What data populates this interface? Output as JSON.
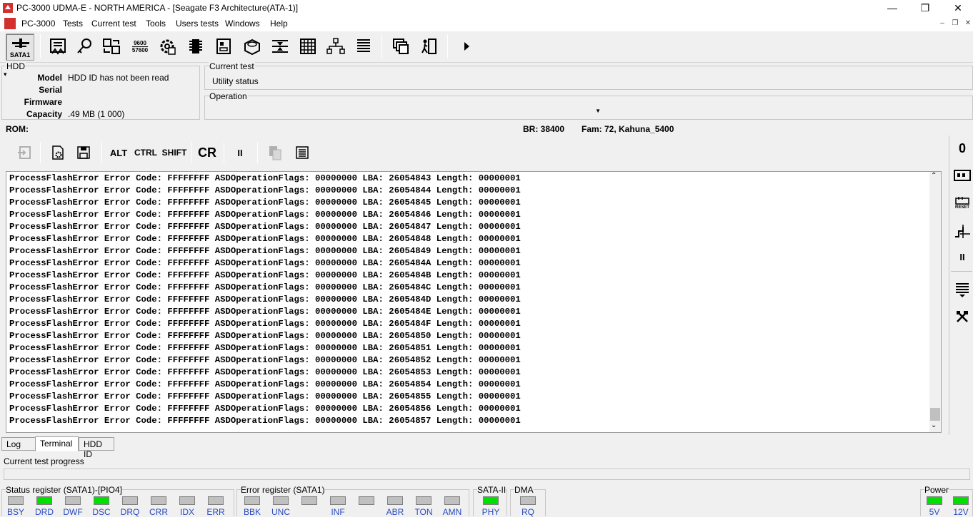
{
  "window": {
    "title": "PC-3000 UDMA-E - NORTH AMERICA - [Seagate F3 Architecture(ATA-1)]",
    "minimize": "—",
    "restore": "❐",
    "close": "✕"
  },
  "menu": {
    "items": [
      "PC-3000",
      "Tests",
      "Current test",
      "Tools",
      "Users tests",
      "Windows",
      "Help"
    ],
    "mdi_min": "–",
    "mdi_restore": "❐",
    "mdi_close": "✕"
  },
  "toolbar": {
    "sata_label": "SATA1",
    "baud_top": "9600",
    "baud_bottom": "57600"
  },
  "hdd": {
    "title": "HDD",
    "model_label": "Model",
    "model_value": "HDD ID has not been read",
    "serial_label": "Serial",
    "serial_value": "",
    "firmware_label": "Firmware",
    "firmware_value": "",
    "capacity_label": "Capacity",
    "capacity_value": ".49 MB (1 000)"
  },
  "current_test": {
    "title": "Current test",
    "value": "Utility status"
  },
  "operation": {
    "title": "Operation",
    "value": ""
  },
  "status_bar": {
    "rom": "ROM:",
    "br": "BR: 38400",
    "fam": "Fam: 72, Kahuna_5400"
  },
  "term_toolbar": {
    "alt": "ALT",
    "ctrl": "CTRL",
    "shift": "SHIFT",
    "cr": "CR",
    "pause": "II"
  },
  "terminal": {
    "lines": [
      "ProcessFlashError Error Code: FFFFFFFF ASDOperationFlags: 00000000 LBA: 26054843 Length: 00000001",
      "ProcessFlashError Error Code: FFFFFFFF ASDOperationFlags: 00000000 LBA: 26054844 Length: 00000001",
      "ProcessFlashError Error Code: FFFFFFFF ASDOperationFlags: 00000000 LBA: 26054845 Length: 00000001",
      "ProcessFlashError Error Code: FFFFFFFF ASDOperationFlags: 00000000 LBA: 26054846 Length: 00000001",
      "ProcessFlashError Error Code: FFFFFFFF ASDOperationFlags: 00000000 LBA: 26054847 Length: 00000001",
      "ProcessFlashError Error Code: FFFFFFFF ASDOperationFlags: 00000000 LBA: 26054848 Length: 00000001",
      "ProcessFlashError Error Code: FFFFFFFF ASDOperationFlags: 00000000 LBA: 26054849 Length: 00000001",
      "ProcessFlashError Error Code: FFFFFFFF ASDOperationFlags: 00000000 LBA: 2605484A Length: 00000001",
      "ProcessFlashError Error Code: FFFFFFFF ASDOperationFlags: 00000000 LBA: 2605484B Length: 00000001",
      "ProcessFlashError Error Code: FFFFFFFF ASDOperationFlags: 00000000 LBA: 2605484C Length: 00000001",
      "ProcessFlashError Error Code: FFFFFFFF ASDOperationFlags: 00000000 LBA: 2605484D Length: 00000001",
      "ProcessFlashError Error Code: FFFFFFFF ASDOperationFlags: 00000000 LBA: 2605484E Length: 00000001",
      "ProcessFlashError Error Code: FFFFFFFF ASDOperationFlags: 00000000 LBA: 2605484F Length: 00000001",
      "ProcessFlashError Error Code: FFFFFFFF ASDOperationFlags: 00000000 LBA: 26054850 Length: 00000001",
      "ProcessFlashError Error Code: FFFFFFFF ASDOperationFlags: 00000000 LBA: 26054851 Length: 00000001",
      "ProcessFlashError Error Code: FFFFFFFF ASDOperationFlags: 00000000 LBA: 26054852 Length: 00000001",
      "ProcessFlashError Error Code: FFFFFFFF ASDOperationFlags: 00000000 LBA: 26054853 Length: 00000001",
      "ProcessFlashError Error Code: FFFFFFFF ASDOperationFlags: 00000000 LBA: 26054854 Length: 00000001",
      "ProcessFlashError Error Code: FFFFFFFF ASDOperationFlags: 00000000 LBA: 26054855 Length: 00000001",
      "ProcessFlashError Error Code: FFFFFFFF ASDOperationFlags: 00000000 LBA: 26054856 Length: 00000001",
      "ProcessFlashError Error Code: FFFFFFFF ASDOperationFlags: 00000000 LBA: 26054857 Length: 00000001"
    ]
  },
  "right_toolbar": {
    "power_label": "0",
    "reset_label": "RESET",
    "pause": "II"
  },
  "tabs": [
    {
      "label": "Log",
      "active": false
    },
    {
      "label": "Terminal",
      "active": true
    },
    {
      "label": "HDD ID",
      "active": false
    }
  ],
  "progress": {
    "label": "Current test progress",
    "value": 0
  },
  "registers": {
    "status": {
      "title": "Status register (SATA1)-[PIO4]",
      "bits": [
        {
          "label": "BSY",
          "on": false
        },
        {
          "label": "DRD",
          "on": true
        },
        {
          "label": "DWF",
          "on": false
        },
        {
          "label": "DSC",
          "on": true
        },
        {
          "label": "DRQ",
          "on": false
        },
        {
          "label": "CRR",
          "on": false
        },
        {
          "label": "IDX",
          "on": false
        },
        {
          "label": "ERR",
          "on": false
        }
      ]
    },
    "error": {
      "title": "Error register (SATA1)",
      "bits": [
        {
          "label": "BBK",
          "on": false
        },
        {
          "label": "UNC",
          "on": false
        },
        {
          "label": "",
          "on": false
        },
        {
          "label": "INF",
          "on": false
        },
        {
          "label": "",
          "on": false
        },
        {
          "label": "ABR",
          "on": false
        },
        {
          "label": "TON",
          "on": false
        },
        {
          "label": "AMN",
          "on": false
        }
      ]
    },
    "sata2": {
      "title": "SATA-II",
      "bits": [
        {
          "label": "PHY",
          "on": true
        }
      ]
    },
    "dma": {
      "title": "DMA",
      "bits": [
        {
          "label": "RQ",
          "on": false
        }
      ]
    },
    "power": {
      "title": "Power",
      "bits": [
        {
          "label": "5V",
          "on": true
        },
        {
          "label": "12V",
          "on": true
        }
      ]
    }
  },
  "colors": {
    "led_on": "#00e000",
    "led_off": "#c0c0c0",
    "bit_label": "#2a4cc0",
    "app_icon": "#d32f2f"
  }
}
